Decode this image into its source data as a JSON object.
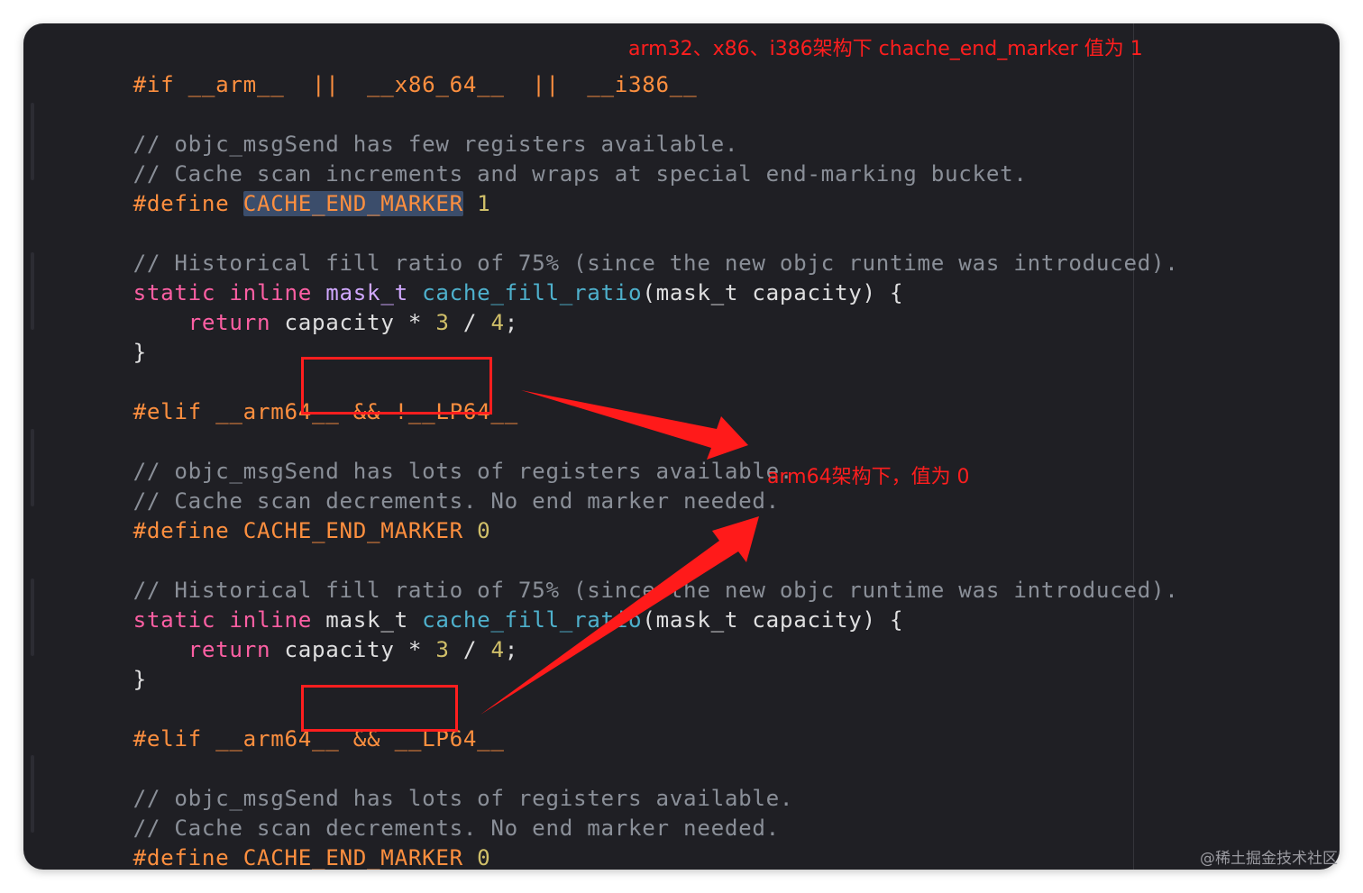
{
  "code": {
    "if_line": {
      "directive": "#if",
      "rest": " __arm__  ||  __x86_64__  ||  __i386__"
    },
    "block1": {
      "comment1": "// objc_msgSend has few registers available.",
      "comment2": "// Cache scan increments and wraps at special end-marking bucket.",
      "define_kw": "#define",
      "define_name": "CACHE_END_MARKER",
      "define_val": "1",
      "hist_comment": "// Historical fill ratio of 75% (since the new objc runtime was introduced).",
      "func_static": "static",
      "func_inline": "inline",
      "func_type": "mask_t",
      "func_name": "cache_fill_ratio",
      "func_args": "(mask_t capacity) {",
      "ret_kw": "return",
      "ret_expr_a": " capacity * ",
      "ret_num_a": "3",
      "ret_expr_b": " / ",
      "ret_num_b": "4",
      "ret_end": ";",
      "close": "}"
    },
    "elif1_line": {
      "directive": "#elif",
      "rest": " __arm64__ && ",
      "cond": "!__LP64__"
    },
    "block2": {
      "comment1": "// objc_msgSend has lots of registers available.",
      "comment2": "// Cache scan decrements. No end marker needed.",
      "define_kw": "#define",
      "define_name": "CACHE_END_MARKER",
      "define_val": "0",
      "hist_comment": "// Historical fill ratio of 75% (since the new objc runtime was introduced).",
      "func_static": "static",
      "func_inline": "inline",
      "func_type": "mask_t",
      "func_name": "cache_fill_ratio",
      "func_args": "(mask_t capacity) {",
      "ret_kw": "return",
      "ret_expr_a": " capacity * ",
      "ret_num_a": "3",
      "ret_expr_b": " / ",
      "ret_num_b": "4",
      "ret_end": ";",
      "close": "}"
    },
    "elif2_line": {
      "directive": "#elif",
      "rest": " __arm64__ && ",
      "cond": "__LP64__"
    },
    "block3": {
      "comment1": "// objc_msgSend has lots of registers available.",
      "comment2": "// Cache scan decrements. No end marker needed.",
      "define_kw": "#define",
      "define_name": "CACHE_END_MARKER",
      "define_val": "0"
    }
  },
  "annotations": {
    "top": "arm32、x86、i386架构下  chache_end_marker 值为 1",
    "arm64": "arm64架构下，值为 0"
  },
  "watermark": "@稀土掘金技术社区",
  "colors": {
    "background": "#1f1f24",
    "preprocessor": "#fd8f3f",
    "comment": "#8a8f98",
    "keyword": "#fc5fa3",
    "number": "#d0bf69",
    "annotation": "#ff1e1e"
  }
}
